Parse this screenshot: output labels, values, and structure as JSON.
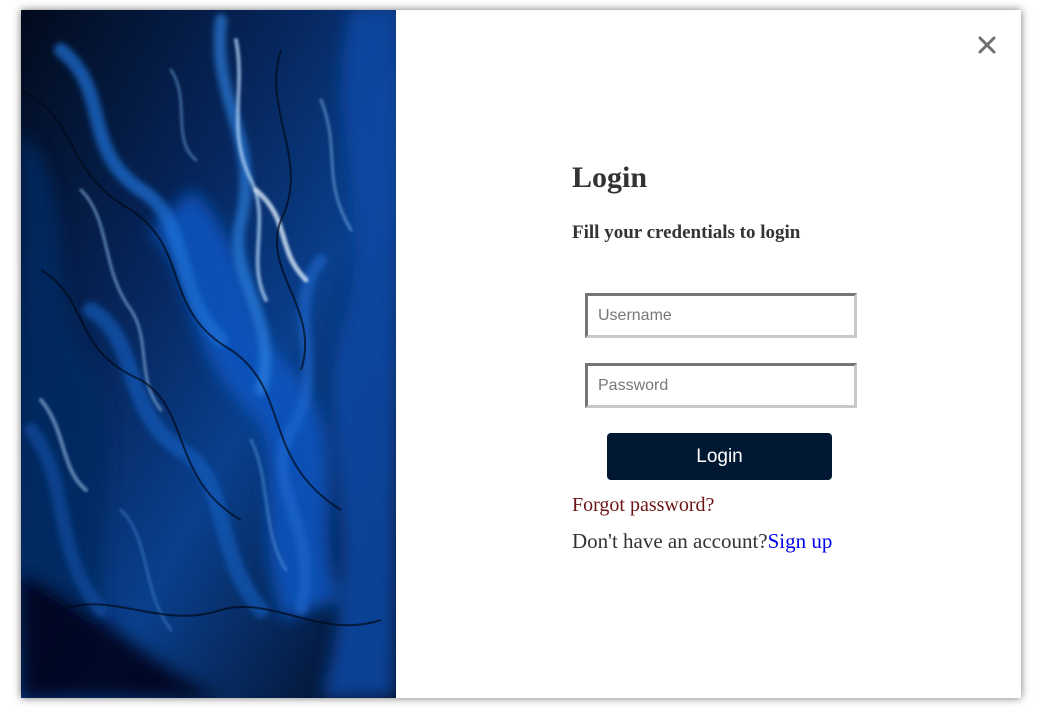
{
  "login": {
    "title": "Login",
    "subtitle": "Fill your credentials to login",
    "username_placeholder": "Username",
    "password_placeholder": "Password",
    "submit_label": "Login",
    "forgot_label": "Forgot password?",
    "signup_prompt": "Don't have an account?",
    "signup_label": "Sign up"
  },
  "icons": {
    "close": "close-icon"
  },
  "colors": {
    "button_bg": "#011833",
    "forgot_link": "#6b1414",
    "signup_link": "#0000ee",
    "text": "#333333",
    "art_base": "#031027"
  }
}
